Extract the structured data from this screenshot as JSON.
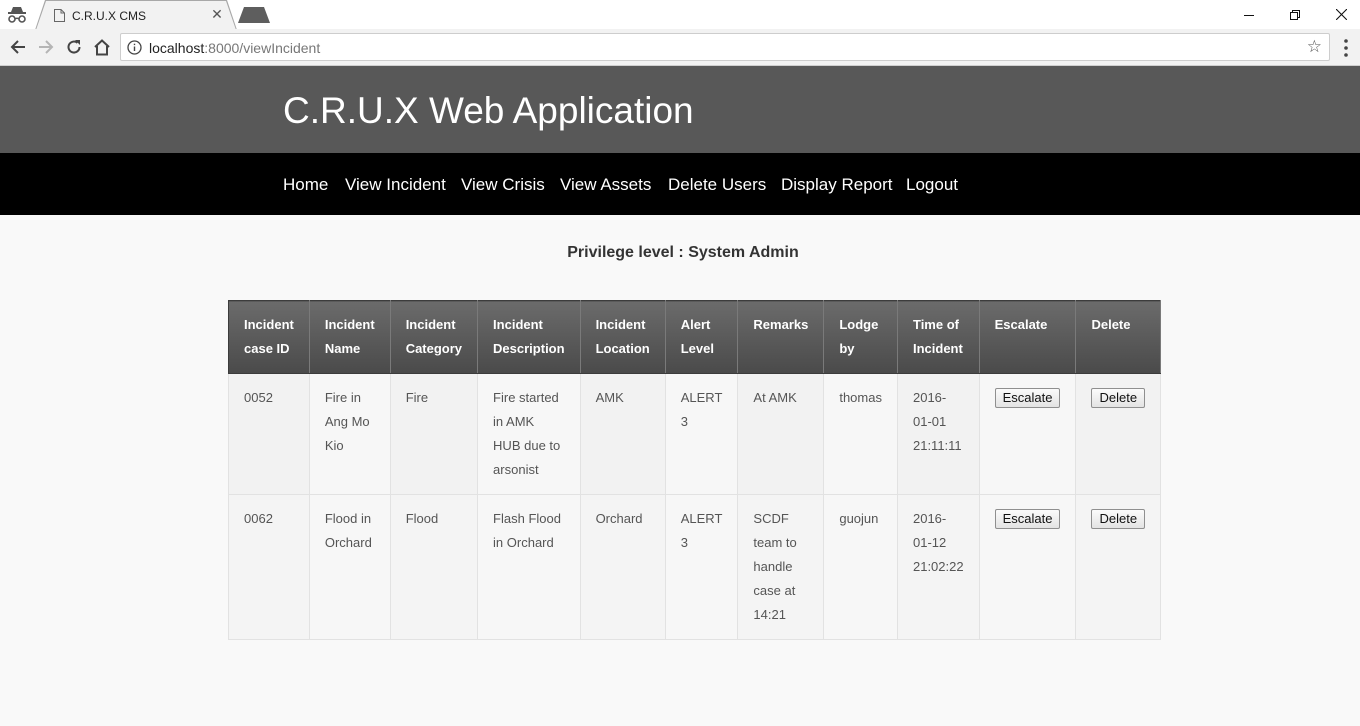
{
  "browser": {
    "tab_title": "C.R.U.X CMS",
    "url_host": "localhost",
    "url_path": ":8000/viewIncident"
  },
  "app": {
    "title": "C.R.U.X Web Application"
  },
  "nav": {
    "items": [
      "Home",
      "View Incident",
      "View Crisis",
      "View Assets",
      "Delete Users",
      "Display Report",
      "Logout"
    ]
  },
  "privilege_text": "Privilege level : System Admin",
  "table": {
    "headers": [
      [
        "Incident",
        "case ID"
      ],
      [
        "Incident",
        "Name"
      ],
      [
        "Incident",
        "Category"
      ],
      [
        "Incident",
        "Description"
      ],
      [
        "Incident",
        "Location"
      ],
      [
        "Alert",
        "Level"
      ],
      [
        "Remarks"
      ],
      [
        "Lodge",
        "by"
      ],
      [
        "Time of",
        "Incident"
      ],
      [
        "Escalate"
      ],
      [
        "Delete"
      ]
    ],
    "rows": [
      {
        "case_id": "0052",
        "name": [
          "Fire in",
          "Ang Mo",
          "Kio"
        ],
        "category": "Fire",
        "description": [
          "Fire started",
          "in AMK",
          "HUB due to",
          "arsonist"
        ],
        "location": "AMK",
        "alert": [
          "ALERT",
          "3"
        ],
        "remarks": [
          "At AMK"
        ],
        "lodge_by": "thomas",
        "time": [
          "2016-",
          "01-01",
          "21:11:11"
        ],
        "escalate_label": "Escalate",
        "delete_label": "Delete"
      },
      {
        "case_id": "0062",
        "name": [
          "Flood in",
          "Orchard"
        ],
        "category": "Flood",
        "description": [
          "Flash Flood",
          "in Orchard"
        ],
        "location": "Orchard",
        "alert": [
          "ALERT",
          "3"
        ],
        "remarks": [
          "SCDF",
          "team to",
          "handle",
          "case at",
          "14:21"
        ],
        "lodge_by": "guojun",
        "time": [
          "2016-",
          "01-12",
          "21:02:22"
        ],
        "escalate_label": "Escalate",
        "delete_label": "Delete"
      }
    ]
  }
}
